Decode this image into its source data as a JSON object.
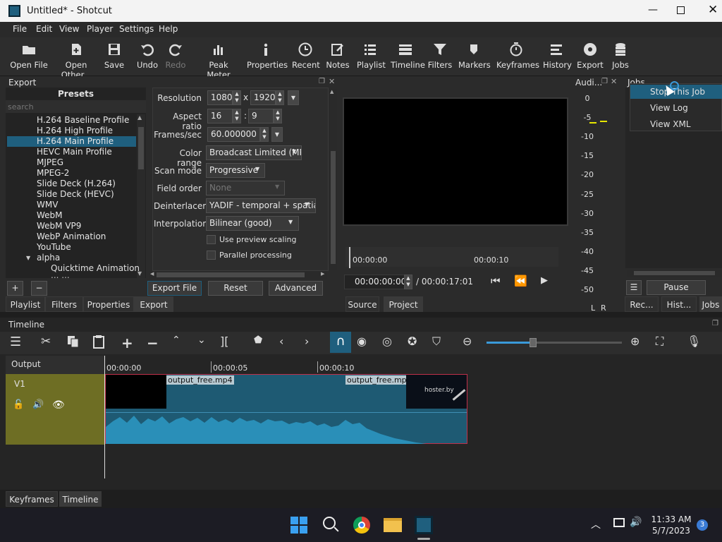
{
  "window": {
    "title": "Untitled* - Shotcut"
  },
  "menu": [
    "File",
    "Edit",
    "View",
    "Player",
    "Settings",
    "Help"
  ],
  "toolbar": {
    "open_file": "Open File",
    "open_other": "Open Other...",
    "save": "Save",
    "undo": "Undo",
    "redo": "Redo",
    "peak_meter": "Peak Meter",
    "properties": "Properties",
    "recent": "Recent",
    "notes": "Notes",
    "playlist": "Playlist",
    "timeline": "Timeline",
    "filters": "Filters",
    "markers": "Markers",
    "keyframes": "Keyframes",
    "history": "History",
    "export": "Export",
    "jobs": "Jobs"
  },
  "export": {
    "panel_title": "Export",
    "presets_title": "Presets",
    "search_placeholder": "search",
    "presets": [
      "H.264 Baseline Profile",
      "H.264 High Profile",
      "H.264 Main Profile",
      "HEVC Main Profile",
      "MJPEG",
      "MPEG-2",
      "Slide Deck (H.264)",
      "Slide Deck (HEVC)",
      "WMV",
      "WebM",
      "WebM VP9",
      "WebP Animation",
      "YouTube"
    ],
    "selected_preset": "H.264 Main Profile",
    "group_alpha": "alpha",
    "sub_item": "Quicktime Animation",
    "sub_item_cut": "... ...",
    "labels": {
      "resolution": "Resolution",
      "aspect": "Aspect ratio",
      "fps": "Frames/sec",
      "color_range": "Color range",
      "scan_mode": "Scan mode",
      "field_order": "Field order",
      "deinterlacer": "Deinterlacer",
      "interpolation": "Interpolation"
    },
    "values": {
      "res_w": "1080",
      "res_x": "x",
      "res_h": "1920",
      "aspect_w": "16",
      "aspect_sep": ":",
      "aspect_h": "9",
      "fps": "60.000000",
      "color_range": "Broadcast Limited (MPE",
      "scan_mode": "Progressive",
      "field_order": "None",
      "deinterlacer": "YADIF - temporal + spatial",
      "interpolation": "Bilinear (good)"
    },
    "chk_preview": "Use preview scaling",
    "chk_parallel": "Parallel processing",
    "btn_export": "Export File",
    "btn_reset": "Reset",
    "btn_advanced": "Advanced"
  },
  "left_tabs": [
    "Playlist",
    "Filters",
    "Properties",
    "Export"
  ],
  "player": {
    "ruler": [
      "00:00:00",
      "00:00:10"
    ],
    "timecode": "00:00:00:00",
    "duration": "/ 00:00:17:01",
    "tabs": [
      "Source",
      "Project"
    ]
  },
  "audio": {
    "title": "Audi...",
    "scale": [
      "0",
      "-5",
      "-10",
      "-15",
      "-20",
      "-25",
      "-30",
      "-35",
      "-40",
      "-45",
      "-50"
    ],
    "l": "L",
    "r": "R"
  },
  "jobs": {
    "title": "Jobs",
    "context_menu": [
      "Stop This Job",
      "View Log",
      "View XML"
    ],
    "pause": "Pause",
    "tabs": [
      "Rec...",
      "Hist...",
      "Jobs"
    ]
  },
  "timeline": {
    "title": "Timeline",
    "output": "Output",
    "track": "V1",
    "ruler": [
      "00:00:00",
      "00:00:05",
      "00:00:10"
    ],
    "clip_labels": [
      "output_free.mp4",
      "output_free.mp4"
    ],
    "thumb_text": "hoster.by"
  },
  "bottom_tabs": [
    "Keyframes",
    "Timeline"
  ],
  "taskbar": {
    "time": "11:33 AM",
    "date": "5/7/2023",
    "badge": "3"
  },
  "colors": {
    "accent": "#1f5f7e",
    "track": "#6e6e24",
    "clip": "#1e5a73",
    "wave": "#2a8fb8",
    "meter": "#e6e600"
  }
}
